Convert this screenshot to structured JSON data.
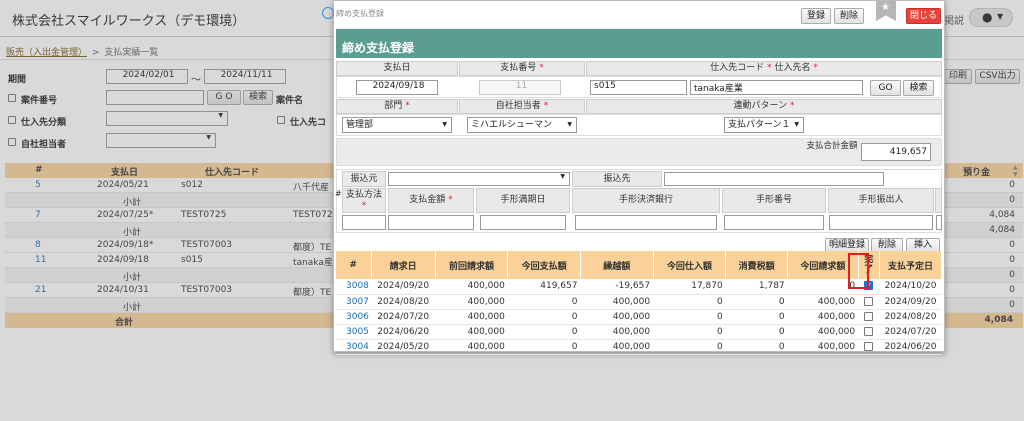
{
  "app": {
    "company": "株式会社スマイルワークス（デモ環境）",
    "breadcrumb_link": "販売（入出金管理）",
    "breadcrumb_sep": ">",
    "breadcrumb_current": "支払実績一覧",
    "right_link": "掲説",
    "print_label": "印刷",
    "csv_label": "CSV出力"
  },
  "filters": {
    "period_label": "期間",
    "date_from": "2024/02/01",
    "tilde": "〜",
    "date_to": "2024/11/11",
    "case_no_label": "案件番号",
    "go_label": "G O",
    "search_label": "検索",
    "case_name_label": "案件名",
    "supplier_class_label": "仕入先分類",
    "supplier_code_label": "仕入先コ",
    "own_staff_label": "自社担当者"
  },
  "bg_table": {
    "headers": [
      "#",
      "支払日",
      "仕入先コード",
      "",
      "預り金"
    ],
    "rows": [
      {
        "no": "5",
        "date": "2024/05/21",
        "code": "s012",
        "name": "八千代産",
        "deposit": "0",
        "type": "row"
      },
      {
        "no": "",
        "date": "小計",
        "code": "",
        "name": "",
        "deposit": "0",
        "type": "sub"
      },
      {
        "no": "7",
        "date": "2024/07/25*",
        "code": "TEST0725",
        "name": "TEST072",
        "deposit": "4,084",
        "type": "row"
      },
      {
        "no": "",
        "date": "小計",
        "code": "",
        "name": "",
        "deposit": "4,084",
        "type": "sub"
      },
      {
        "no": "8",
        "date": "2024/09/18*",
        "code": "TEST07003",
        "name": "都度）TE",
        "deposit": "0",
        "type": "row"
      },
      {
        "no": "11",
        "date": "2024/09/18",
        "code": "s015",
        "name": "tanaka産",
        "deposit": "0",
        "type": "row"
      },
      {
        "no": "",
        "date": "小計",
        "code": "",
        "name": "",
        "deposit": "0",
        "type": "sub"
      },
      {
        "no": "21",
        "date": "2024/10/31",
        "code": "TEST07003",
        "name": "都度）TE",
        "deposit": "0",
        "type": "row"
      },
      {
        "no": "",
        "date": "小計",
        "code": "",
        "name": "",
        "deposit": "0",
        "type": "sub"
      }
    ],
    "total_label": "合計",
    "total_value": "4,084"
  },
  "modal": {
    "window_title": "締め支払登録",
    "register_label": "登録",
    "delete_label": "削除",
    "close_label": "閉じる",
    "header_title": "締め支払登録",
    "pay_date_label": "支払日",
    "pay_no_label": "支払番号",
    "req": "*",
    "supplier_label": "仕入先コード",
    "supplier_name_label": "仕入先名",
    "pay_date": "2024/09/18",
    "pay_no": "11",
    "supplier_code": "s015",
    "supplier_name": "tanaka産業",
    "go_label": "GO",
    "search_label": "検索",
    "dept_label": "部門",
    "staff_label": "自社担当者",
    "pattern_label": "連動パターン",
    "dept": "管理部",
    "staff": "ミハエルシューマン",
    "pattern": "支払パターン１",
    "total_label": "支払合計金額",
    "total_value": "419,657",
    "transfer_from_label": "振込元",
    "transfer_to_label": "振込先",
    "hash": "#",
    "method_label": "支払方法",
    "amount_label": "支払金額",
    "due_label": "手形満期日",
    "bank_label": "手形決済銀行",
    "bill_no_label": "手形番号",
    "issuer_label": "手形振出人",
    "detail_register_label": "明細登録",
    "detail_delete_label": "削除",
    "insert_label": "挿入",
    "detail_headers": [
      "#",
      "請求日",
      "前回請求額",
      "今回支払額",
      "繰越額",
      "今回仕入額",
      "消費税額",
      "今回請求額",
      "完了",
      "支払予定日"
    ],
    "detail_rows": [
      {
        "id": "3008",
        "bill_date": "2024/09/20",
        "prev": "400,000",
        "paid": "419,657",
        "carry": "-19,657",
        "purchase": "17,870",
        "tax": "1,787",
        "bill": "0",
        "done": true,
        "due": "2024/10/20"
      },
      {
        "id": "3007",
        "bill_date": "2024/08/20",
        "prev": "400,000",
        "paid": "0",
        "carry": "400,000",
        "purchase": "0",
        "tax": "0",
        "bill": "400,000",
        "done": false,
        "due": "2024/09/20"
      },
      {
        "id": "3006",
        "bill_date": "2024/07/20",
        "prev": "400,000",
        "paid": "0",
        "carry": "400,000",
        "purchase": "0",
        "tax": "0",
        "bill": "400,000",
        "done": false,
        "due": "2024/08/20"
      },
      {
        "id": "3005",
        "bill_date": "2024/06/20",
        "prev": "400,000",
        "paid": "0",
        "carry": "400,000",
        "purchase": "0",
        "tax": "0",
        "bill": "400,000",
        "done": false,
        "due": "2024/07/20"
      },
      {
        "id": "3004",
        "bill_date": "2024/05/20",
        "prev": "400,000",
        "paid": "0",
        "carry": "400,000",
        "purchase": "0",
        "tax": "0",
        "bill": "400,000",
        "done": false,
        "due": "2024/06/20"
      }
    ]
  },
  "colors": {
    "teal": "#5a9e92",
    "orange_header": "#f9d199",
    "close_red": "#e8423a",
    "link_blue": "#1a6db5"
  }
}
